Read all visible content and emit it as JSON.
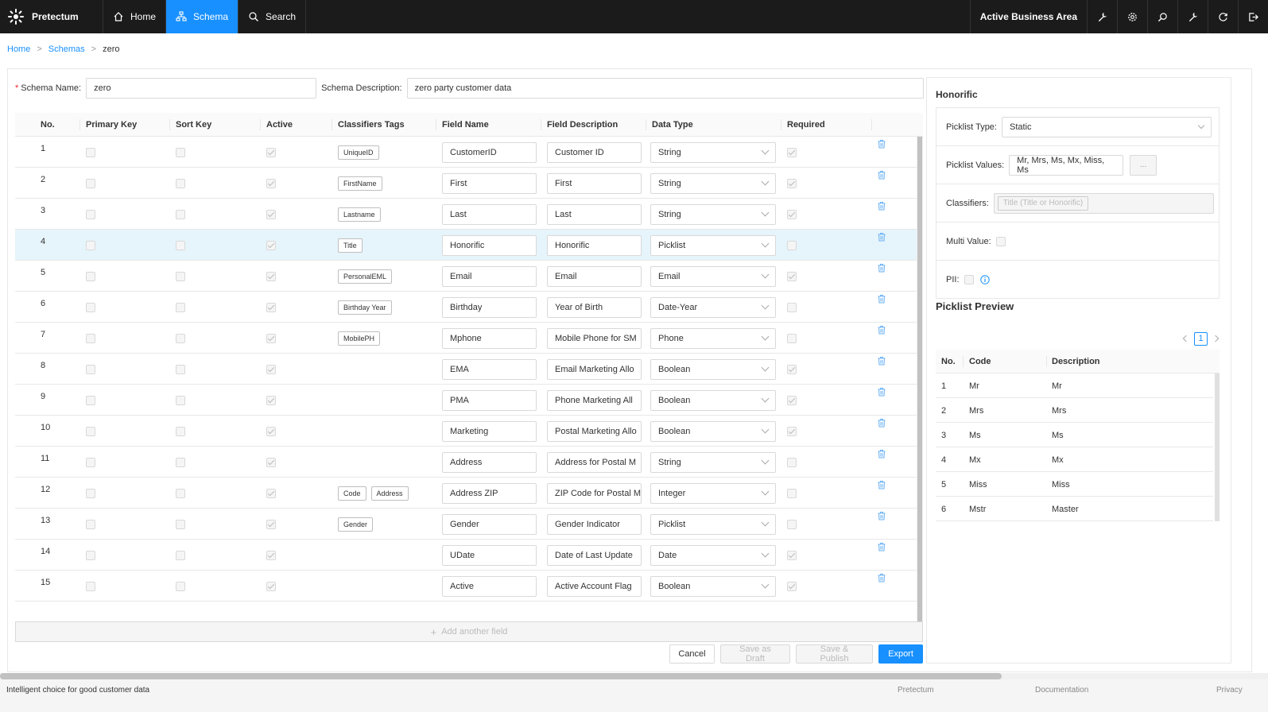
{
  "app": {
    "brand": "Pretectum",
    "nav": [
      {
        "label": "Home",
        "icon": "home-icon"
      },
      {
        "label": "Schema",
        "icon": "schema-icon",
        "active": true
      },
      {
        "label": "Search",
        "icon": "search-icon"
      }
    ],
    "active_area": "Active Business Area",
    "accent": "#1890ff"
  },
  "breadcrumb": {
    "home": "Home",
    "schemas": "Schemas",
    "current": "zero",
    "sep": ">"
  },
  "schema": {
    "name_label": "Schema Name:",
    "name_value": "zero",
    "desc_label": "Schema Description:",
    "desc_value": "zero party customer data"
  },
  "table": {
    "headers": {
      "no": "No.",
      "primary_key": "Primary Key",
      "sort_key": "Sort Key",
      "active": "Active",
      "tags": "Classifiers Tags",
      "field_name": "Field Name",
      "field_desc": "Field Description",
      "data_type": "Data Type",
      "required": "Required"
    },
    "rows": [
      {
        "no": "1",
        "active": true,
        "tags": [
          "UniqueID"
        ],
        "field": "CustomerID",
        "desc": "Customer ID",
        "type": "String",
        "required": true
      },
      {
        "no": "2",
        "active": true,
        "tags": [
          "FirstName"
        ],
        "field": "First",
        "desc": "First",
        "type": "String",
        "required": true
      },
      {
        "no": "3",
        "active": true,
        "tags": [
          "Lastname"
        ],
        "field": "Last",
        "desc": "Last",
        "type": "String",
        "required": true
      },
      {
        "no": "4",
        "active": true,
        "tags": [
          "Title"
        ],
        "field": "Honorific",
        "desc": "Honorific",
        "type": "Picklist",
        "required": false,
        "selected": true
      },
      {
        "no": "5",
        "active": true,
        "tags": [
          "PersonalEML"
        ],
        "field": "Email",
        "desc": "Email",
        "type": "Email",
        "required": true
      },
      {
        "no": "6",
        "active": true,
        "tags": [
          "Birthday Year"
        ],
        "field": "Birthday",
        "desc": "Year of Birth",
        "type": "Date-Year",
        "required": false
      },
      {
        "no": "7",
        "active": true,
        "tags": [
          "MobilePH"
        ],
        "field": "Mphone",
        "desc": "Mobile Phone for SM",
        "type": "Phone",
        "required": false
      },
      {
        "no": "8",
        "active": true,
        "tags": [],
        "field": "EMA",
        "desc": "Email Marketing Allo",
        "type": "Boolean",
        "required": true
      },
      {
        "no": "9",
        "active": true,
        "tags": [],
        "field": "PMA",
        "desc": "Phone Marketing All",
        "type": "Boolean",
        "required": true
      },
      {
        "no": "10",
        "active": true,
        "tags": [],
        "field": "Marketing",
        "desc": "Postal Marketing Allo",
        "type": "Boolean",
        "required": true
      },
      {
        "no": "11",
        "active": true,
        "tags": [],
        "field": "Address",
        "desc": "Address for Postal M",
        "type": "String",
        "required": false
      },
      {
        "no": "12",
        "active": true,
        "tags": [
          "Code",
          "Address"
        ],
        "field": "Address ZIP",
        "desc": "ZIP Code for Postal M",
        "type": "Integer",
        "required": false
      },
      {
        "no": "13",
        "active": true,
        "tags": [
          "Gender"
        ],
        "field": "Gender",
        "desc": "Gender Indicator",
        "type": "Picklist",
        "required": false
      },
      {
        "no": "14",
        "active": true,
        "tags": [],
        "field": "UDate",
        "desc": "Date of Last Update",
        "type": "Date",
        "required": true
      },
      {
        "no": "15",
        "active": true,
        "tags": [],
        "field": "Active",
        "desc": "Active Account Flag",
        "type": "Boolean",
        "required": true
      }
    ],
    "add_field": "Add another field"
  },
  "buttons": {
    "cancel": "Cancel",
    "save_draft": "Save as Draft",
    "save_publish": "Save & Publish",
    "export": "Export"
  },
  "panel": {
    "title": "Honorific",
    "picklist_type_label": "Picklist Type:",
    "picklist_type_value": "Static",
    "picklist_values_label": "Picklist Values:",
    "picklist_values_value": "Mr, Mrs, Ms, Mx, Miss, Ms",
    "ellipsis": "...",
    "classifiers_label": "Classifiers:",
    "classifiers_tag": "Title (Title or Honorific)",
    "multi_value_label": "Multi Value:",
    "pii_label": "PII:"
  },
  "preview": {
    "title": "Picklist Preview",
    "page": "1",
    "headers": {
      "no": "No.",
      "code": "Code",
      "desc": "Description"
    },
    "rows": [
      {
        "no": "1",
        "code": "Mr",
        "desc": "Mr"
      },
      {
        "no": "2",
        "code": "Mrs",
        "desc": "Mrs"
      },
      {
        "no": "3",
        "code": "Ms",
        "desc": "Ms"
      },
      {
        "no": "4",
        "code": "Mx",
        "desc": "Mx"
      },
      {
        "no": "5",
        "code": "Miss",
        "desc": "Miss"
      },
      {
        "no": "6",
        "code": "Mstr",
        "desc": "Master"
      }
    ]
  },
  "footer": {
    "tagline": "Intelligent choice for good customer data",
    "links": [
      "Pretectum",
      "Documentation",
      "Privacy"
    ]
  }
}
